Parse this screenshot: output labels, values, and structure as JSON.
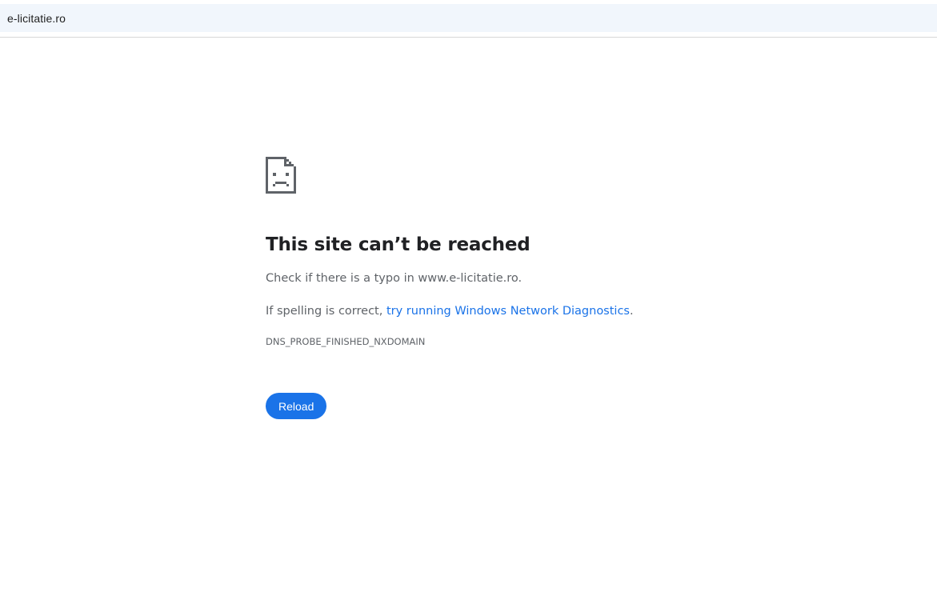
{
  "address_bar": {
    "url": "e-licitatie.ro"
  },
  "error_page": {
    "icon": "sad-page-icon",
    "title": "This site can’t be reached",
    "check_text": "Check if there is a typo in www.e-licitatie.ro.",
    "spelling_prefix": "If spelling is correct, ",
    "diagnostics_link": "try running Windows Network Diagnostics",
    "spelling_suffix": ".",
    "error_code": "DNS_PROBE_FINISHED_NXDOMAIN",
    "reload_label": "Reload"
  },
  "colors": {
    "accent": "#1a73e8",
    "text_primary": "#202124",
    "text_secondary": "#5f6368",
    "address_bar_bg": "#f1f6fc"
  }
}
